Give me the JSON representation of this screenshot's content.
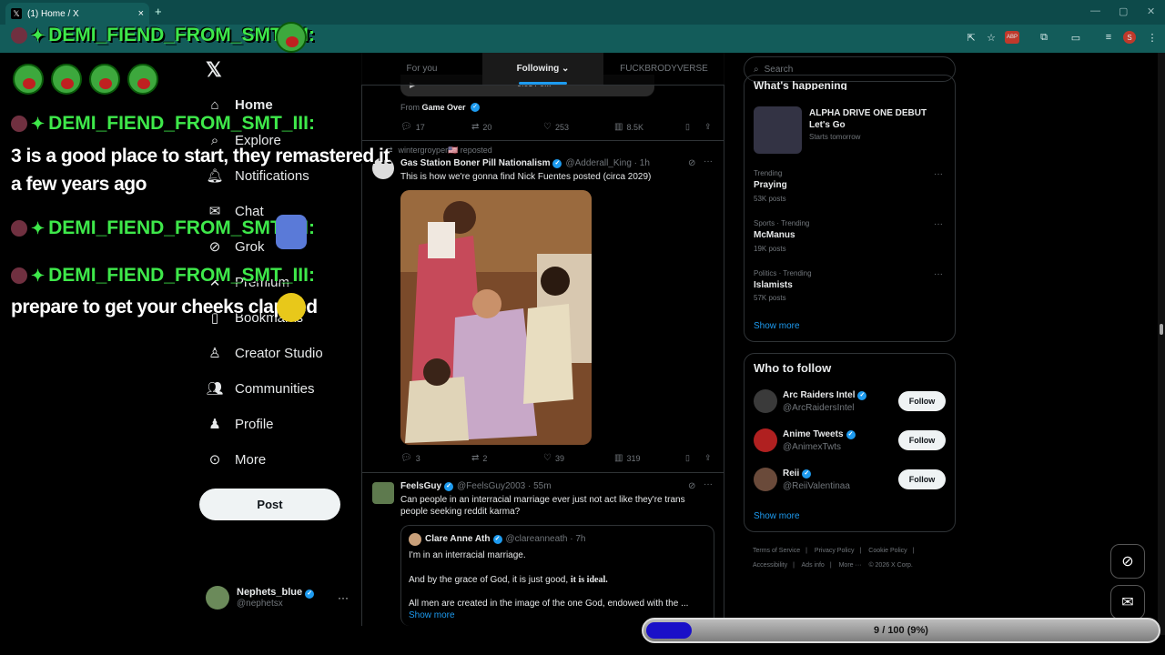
{
  "browser": {
    "tab_title": "(1) Home / X",
    "tab_close": "×",
    "new_tab": "+",
    "minimize": "—",
    "maximize": "▢",
    "close": "✕",
    "profile_initial": "S",
    "extension_badge": "ABP"
  },
  "sidebar": {
    "items": [
      {
        "label": "Home",
        "icon": "home-icon"
      },
      {
        "label": "Explore",
        "icon": "search-icon"
      },
      {
        "label": "Notifications",
        "icon": "bell-icon",
        "badge": "1"
      },
      {
        "label": "Chat",
        "icon": "mail-icon"
      },
      {
        "label": "Grok",
        "icon": "grok-icon"
      },
      {
        "label": "Premium",
        "icon": "x-icon"
      },
      {
        "label": "Bookmarks",
        "icon": "bookmark-icon"
      },
      {
        "label": "Creator Studio",
        "icon": "creator-icon"
      },
      {
        "label": "Communities",
        "icon": "people-icon"
      },
      {
        "label": "Profile",
        "icon": "person-icon"
      },
      {
        "label": "More",
        "icon": "more-icon"
      }
    ],
    "post_button": "Post",
    "account": {
      "name": "Nephets_blue",
      "handle": "@nephetsx",
      "more": "···"
    }
  },
  "feed_tabs": [
    "For you",
    "Following",
    "FUCKBRODYVERSE"
  ],
  "tweet_prev": {
    "video_time": "0:05 / 0:..",
    "from_label": "From",
    "from_name": "Game Over",
    "replies": "17",
    "reposts": "20",
    "likes": "253",
    "views": "8.5K"
  },
  "tweet1": {
    "repost_by": "wintergroyper🇺🇸 reposted",
    "name": "Gas Station Boner Pill Nationalism",
    "handle": "@Adderall_King · 1h",
    "text": "This is how we're gonna find Nick Fuentes posted (circa 2029)",
    "replies": "3",
    "reposts": "2",
    "likes": "39",
    "views": "319"
  },
  "tweet2": {
    "name": "FeelsGuy",
    "handle": "@FeelsGuy2003 · 55m",
    "text": "Can people in an interracial marriage ever just not act like they're trans people seeking reddit karma?",
    "quote": {
      "name": "Clare Anne Ath",
      "handle": "@clareanneath · 7h",
      "line1": "I'm in an interracial marriage.",
      "line2a": "And by the grace of God, it is just good, ",
      "line2b": "it is ideal.",
      "line3": "All men are created in the image of the one God, endowed with the ...",
      "show_more": "Show more"
    }
  },
  "right": {
    "search_placeholder": "Search",
    "happening_title": "What's happening",
    "event": {
      "title": "ALPHA DRIVE ONE DEBUT",
      "subtitle": "Let's Go",
      "meta": "Starts tomorrow"
    },
    "trends": [
      {
        "context": "Trending",
        "name": "Praying",
        "posts": "53K posts"
      },
      {
        "context": "Sports · Trending",
        "name": "McManus",
        "posts": "19K posts"
      },
      {
        "context": "Politics · Trending",
        "name": "Islamists",
        "posts": "57K posts"
      }
    ],
    "show_more": "Show more",
    "who_title": "Who to follow",
    "who": [
      {
        "name": "Arc Raiders Intel",
        "handle": "@ArcRaidersIntel",
        "btn": "Follow"
      },
      {
        "name": "Anime Tweets",
        "handle": "@AnimexTwts",
        "btn": "Follow"
      },
      {
        "name": "Reii",
        "handle": "@ReiiValentinaa",
        "btn": "Follow"
      }
    ],
    "who_show_more": "Show more",
    "footer": [
      "Terms of Service",
      "|",
      "Privacy Policy",
      "|",
      "Cookie Policy",
      "|",
      "Accessibility",
      "|",
      "Ads info",
      "|",
      "More ···",
      "© 2026 X Corp."
    ]
  },
  "chat": {
    "username": "DEMI_FIEND_FROM_SMT_III:",
    "msg1": "3 is a good place to start, they remastered it",
    "msg1b": "a few years ago",
    "msg2": "prepare to get your cheeks clapped"
  },
  "progress": {
    "label": "9 / 100 (9%)",
    "fraction": 0.09
  }
}
